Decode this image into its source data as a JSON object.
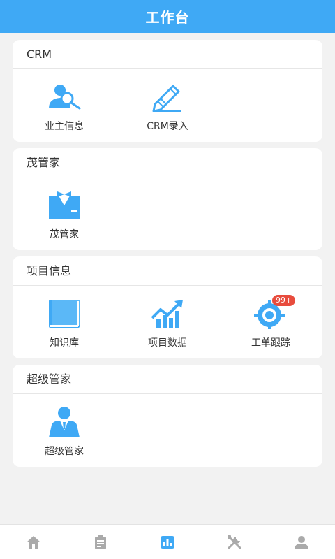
{
  "header": {
    "title": "工作台"
  },
  "sections": [
    {
      "title": "CRM",
      "items": [
        {
          "label": "业主信息",
          "icon": "owner-search-icon"
        },
        {
          "label": "CRM录入",
          "icon": "pencil-entry-icon"
        }
      ]
    },
    {
      "title": "茂管家",
      "items": [
        {
          "label": "茂管家",
          "icon": "butler-icon"
        }
      ]
    },
    {
      "title": "项目信息",
      "items": [
        {
          "label": "知识库",
          "icon": "book-icon"
        },
        {
          "label": "项目数据",
          "icon": "growth-chart-icon"
        },
        {
          "label": "工单跟踪",
          "icon": "target-track-icon",
          "badge": "99+"
        }
      ]
    },
    {
      "title": "超级管家",
      "items": [
        {
          "label": "超级管家",
          "icon": "super-butler-icon"
        }
      ]
    }
  ],
  "tabbar": [
    {
      "name": "home",
      "icon": "home-icon",
      "active": false
    },
    {
      "name": "notes",
      "icon": "clipboard-icon",
      "active": false
    },
    {
      "name": "workbench",
      "icon": "bar-chart-icon",
      "active": true
    },
    {
      "name": "tools",
      "icon": "tools-icon",
      "active": false
    },
    {
      "name": "profile",
      "icon": "user-icon",
      "active": false
    }
  ],
  "colors": {
    "primary": "#3fa9f5",
    "badge": "#e84c3d",
    "inactive_tab": "#aaaaaa",
    "background": "#f2f2f2"
  }
}
